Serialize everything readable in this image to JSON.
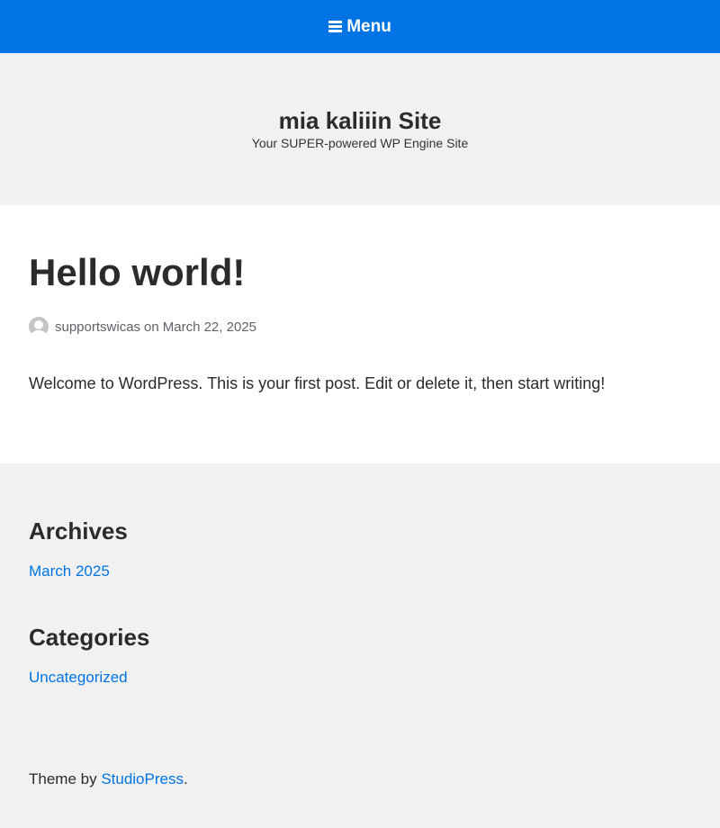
{
  "nav": {
    "menu_label": "Menu",
    "menu_icon": "hamburger-icon"
  },
  "header": {
    "site_title": "mia kaliiin Site",
    "site_description": "Your SUPER-powered WP Engine Site"
  },
  "post": {
    "title": "Hello world!",
    "author": "supportswicas",
    "on": "on",
    "date": "March 22, 2025",
    "content": "Welcome to WordPress. This is your first post. Edit or delete it, then start writing!"
  },
  "widgets": {
    "archives": {
      "title": "Archives",
      "items": [
        "March 2025"
      ]
    },
    "categories": {
      "title": "Categories",
      "items": [
        "Uncategorized"
      ]
    }
  },
  "footer": {
    "prefix": "Theme by ",
    "link_text": "StudioPress",
    "suffix": "."
  },
  "colors": {
    "accent": "#0073e5",
    "background": "#f1f1f1",
    "content_background": "#ffffff"
  }
}
